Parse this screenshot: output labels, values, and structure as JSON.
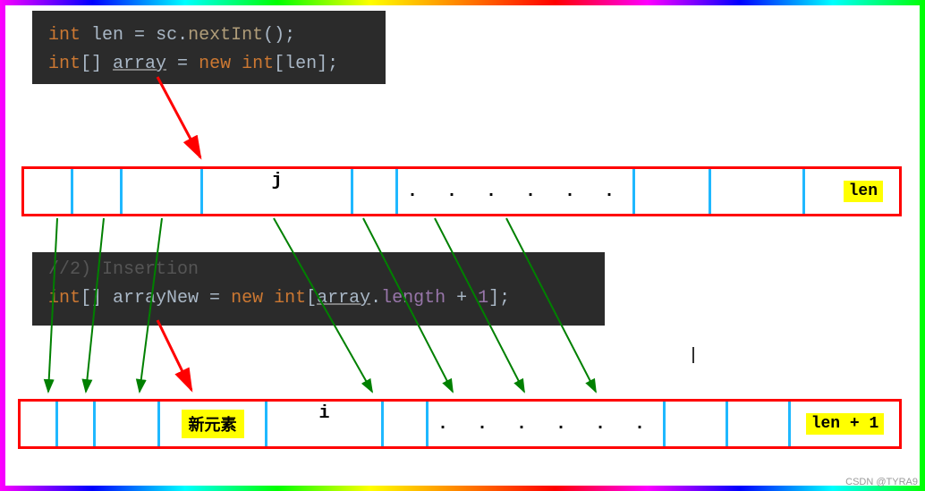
{
  "code1": {
    "line1_kw1": "int",
    "line1_var": "len",
    "line1_eq": " = ",
    "line1_obj": "sc",
    "line1_dot": ".",
    "line1_method": "nextInt",
    "line1_end": "();",
    "line2_kw1": "int",
    "line2_brackets": "[] ",
    "line2_var": "array",
    "line2_eq": " = ",
    "line2_kw2": "new int",
    "line2_end1": "[",
    "line2_len": "len",
    "line2_end2": "];"
  },
  "code2": {
    "faded_top": "//2) Insertion",
    "line1_kw1": "int",
    "line1_brackets": "[] ",
    "line1_var": "arrayNew",
    "line1_eq": " = ",
    "line1_kw2": "new int",
    "line1_end1": "[",
    "line1_ref": "array",
    "line1_dot": ".",
    "line1_prop": "length",
    "line1_plus": " + ",
    "line1_num": "1",
    "line1_end2": "];"
  },
  "array1": {
    "j_label": "j",
    "dots": ". . . . . .",
    "len_label": "len"
  },
  "array2": {
    "new_element": "新元素",
    "i_label": "i",
    "dots": ". . . . . .",
    "len_label": "len + 1"
  },
  "watermark": "CSDN @TYRA9"
}
